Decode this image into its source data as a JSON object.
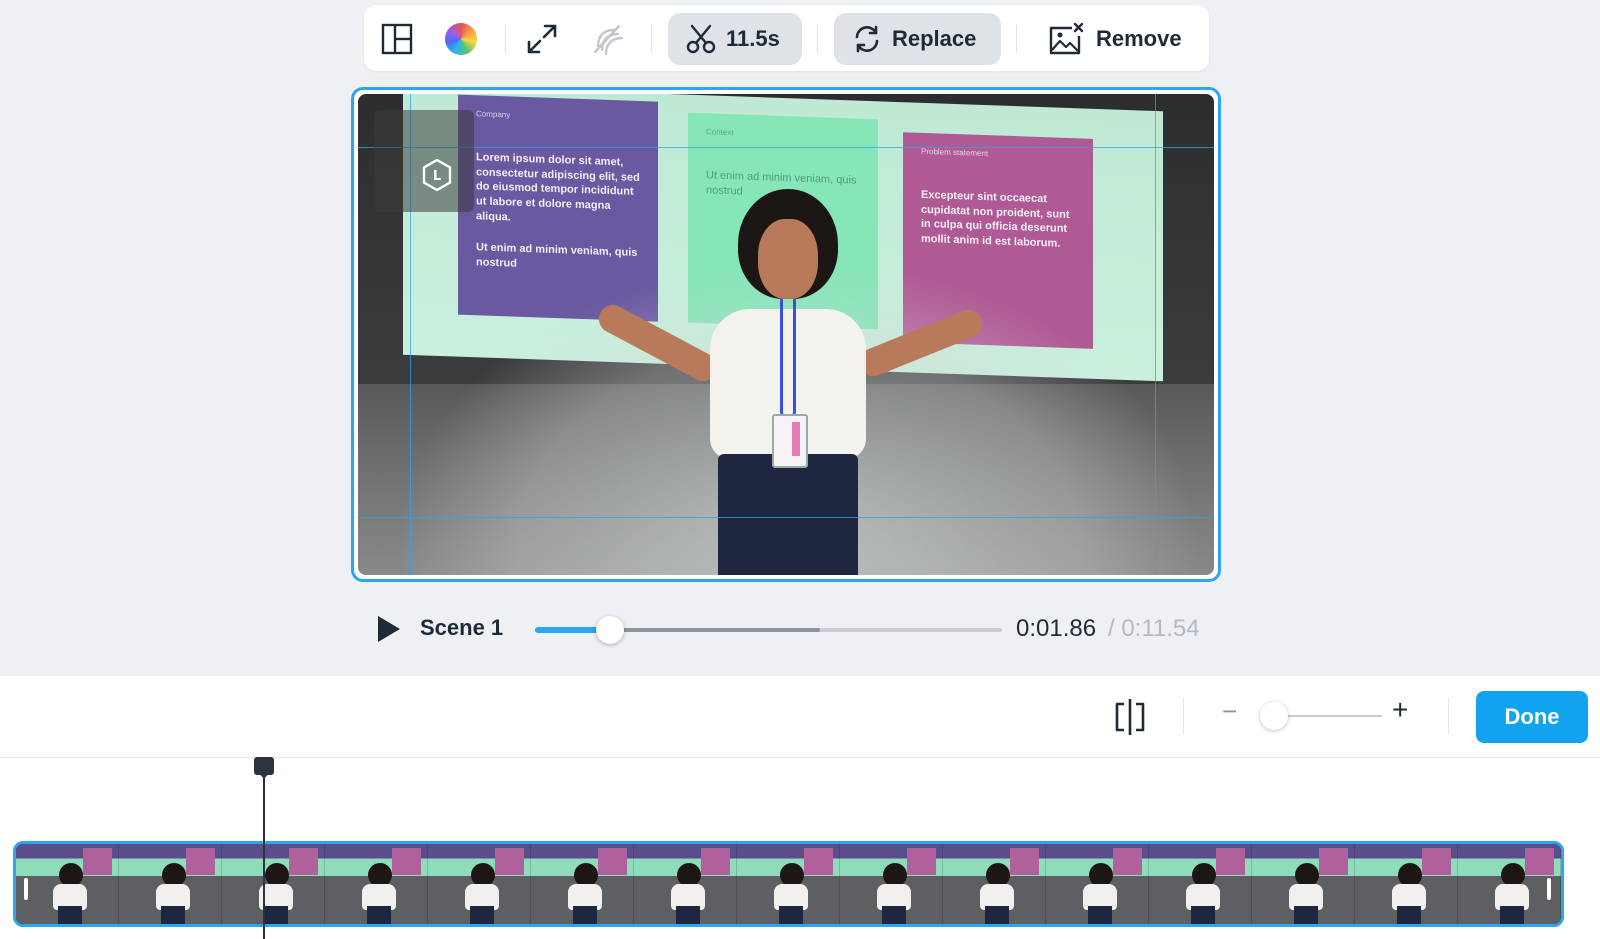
{
  "toolbar": {
    "layout_icon": "layout-panels-icon",
    "color_icon": "color-wheel-icon",
    "resize_icon": "expand-arrows-icon",
    "mute_icon": "audio-muted-icon",
    "trim": {
      "icon": "scissors-icon",
      "label": "11.5s"
    },
    "replace": {
      "icon": "refresh-icon",
      "label": "Replace"
    },
    "remove": {
      "icon": "image-remove-icon",
      "label": "Remove"
    }
  },
  "preview": {
    "logo_letter": "L",
    "accent_color": "#2aa6f2",
    "slides": {
      "purple": {
        "title": "Company",
        "body": "Lorem ipsum dolor sit amet, consectetur adipiscing elit, sed do eiusmod tempor incididunt ut labore et dolore magna aliqua.",
        "body2": "Ut enim ad minim veniam, quis nostrud"
      },
      "green": {
        "title": "Context",
        "body": "Ut enim ad minim veniam, quis nostrud"
      },
      "pink": {
        "title": "Problem statement",
        "body": "Excepteur sint occaecat cupidatat non proident, sunt in culpa qui officia deserunt mollit anim id est laborum."
      }
    }
  },
  "playback": {
    "play_icon": "play-icon",
    "scene_label": "Scene 1",
    "current_time": "0:01.86",
    "total_time": "/ 0:11.54",
    "progress_fraction": 0.161,
    "buffered_fraction": 0.61
  },
  "bottom": {
    "split_icon": "split-clip-icon",
    "zoom_minus": "−",
    "zoom_plus": "+",
    "zoom_fraction": 0.1,
    "done_label": "Done",
    "done_color": "#12a3f0"
  },
  "timeline": {
    "thumbnail_count": 15,
    "playhead_fraction": 0.161
  }
}
